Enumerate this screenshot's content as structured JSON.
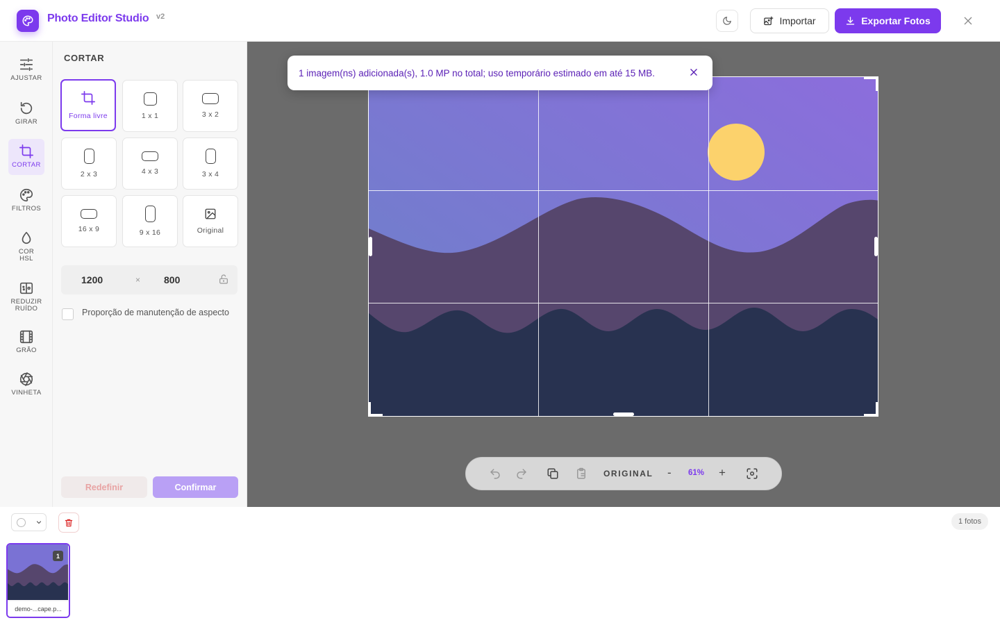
{
  "header": {
    "title": "Photo Editor Studio",
    "version": "v2",
    "import_label": "Importar",
    "export_label": "Exportar Fotos"
  },
  "tools": [
    {
      "label": "AJUSTAR",
      "icon": "sliders-icon"
    },
    {
      "label": "GIRAR",
      "icon": "rotate-icon"
    },
    {
      "label": "CORTAR",
      "icon": "crop-icon",
      "active": true
    },
    {
      "label": "FILTROS",
      "icon": "palette-icon"
    },
    {
      "label": "COR HSL",
      "icon": "droplet-icon"
    },
    {
      "label": "REDUZIR RUÍDO",
      "icon": "noise-icon"
    },
    {
      "label": "GRÃO",
      "icon": "film-icon"
    },
    {
      "label": "VINHETA",
      "icon": "aperture-icon"
    }
  ],
  "crop": {
    "title": "CORTAR",
    "ratios": [
      {
        "label": "Forma livre",
        "selected": true
      },
      {
        "label": "1 x 1"
      },
      {
        "label": "3 x 2"
      },
      {
        "label": "2 x 3"
      },
      {
        "label": "4 x 3"
      },
      {
        "label": "3 x 4"
      },
      {
        "label": "16 x 9"
      },
      {
        "label": "9 x 16"
      },
      {
        "label": "Original"
      }
    ],
    "width": "1200",
    "times": "×",
    "height": "800",
    "keep_aspect_label": "Proporção de manutenção de aspecto",
    "keep_aspect_checked": false,
    "reset_label": "Redefinir",
    "confirm_label": "Confirmar"
  },
  "toast": {
    "message": "1 imagem(ns) adicionada(s), 1.0 MP no total; uso temporário estimado em até 15 MB."
  },
  "canvas_toolbar": {
    "original_label": "ORIGINAL",
    "zoom_out": "-",
    "zoom_level": "61%",
    "zoom_in": "+"
  },
  "filmstrip": {
    "count_label": "1 fotos",
    "items": [
      {
        "number": "1",
        "name": "demo-...cape.p...",
        "selected": true
      }
    ]
  },
  "colors": {
    "accent": "#7c3aed",
    "canvas_bg": "#6b6b6b",
    "sky_top": "#8a6fdc",
    "sky_bottom": "#6a82c8",
    "sun": "#fcd26c",
    "hill_back": "#56466d",
    "hill_front": "#283250"
  }
}
